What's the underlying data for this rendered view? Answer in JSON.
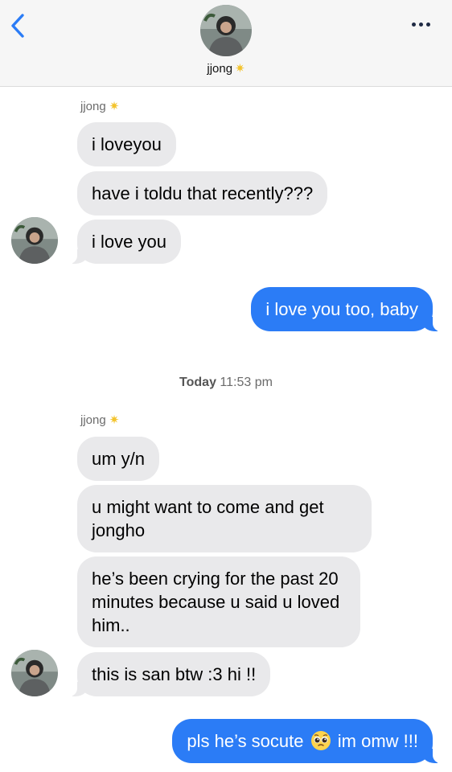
{
  "contact": {
    "name": "jjong",
    "badge_icon": "sparkle-star-icon"
  },
  "header": {
    "back_icon": "chevron-left-icon",
    "more_icon": "ellipsis-icon"
  },
  "colors": {
    "accent": "#2b7cf6",
    "incoming": "#e9e9eb",
    "badge": "#f3c32c"
  },
  "thread": {
    "group1": {
      "sender": "jjong",
      "messages": [
        "i loveyou",
        "have i toldu that recently???",
        "i love you"
      ]
    },
    "outgoing1": "i love you too, baby",
    "timestamp": {
      "day": "Today",
      "time": "11:53 pm"
    },
    "group2": {
      "sender": "jjong",
      "messages": [
        "um y/n",
        "u might want to come and get jongho",
        "he’s been crying for the past 20 minutes because u said u loved him..",
        "this is san btw :3 hi !!"
      ]
    },
    "outgoing2": {
      "before": "pls he’s socute",
      "emoji": "pleading-face-icon",
      "after": "im omw !!!"
    }
  }
}
